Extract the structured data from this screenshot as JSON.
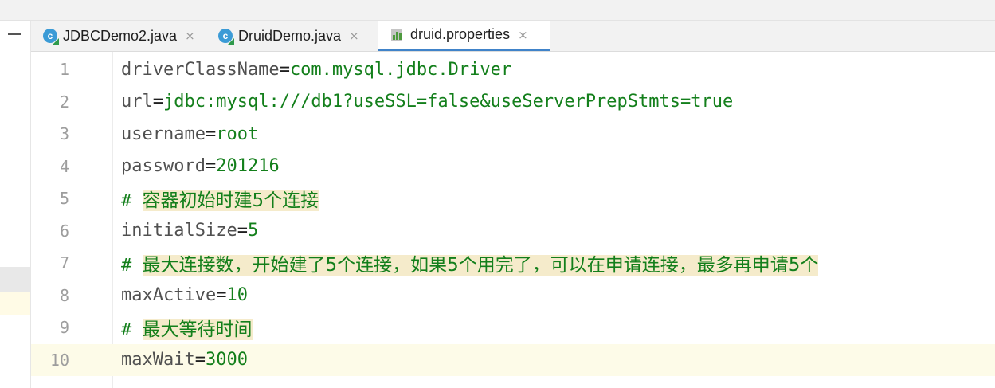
{
  "tabs": [
    {
      "label": "JDBCDemo2.java",
      "icon": "java-class-icon",
      "active": false
    },
    {
      "label": "DruidDemo.java",
      "icon": "java-class-icon",
      "active": false
    },
    {
      "label": "druid.properties",
      "icon": "properties-file-icon",
      "active": true
    }
  ],
  "close_glyph": "×",
  "editor": {
    "current_line": 10,
    "lines": [
      {
        "num": "1",
        "key": "driverClassName",
        "eq": "=",
        "value": "com.mysql.jdbc.Driver"
      },
      {
        "num": "2",
        "key": "url",
        "eq": "=",
        "value": "jdbc:mysql:///db1?useSSL=false&useServerPrepStmts=true"
      },
      {
        "num": "3",
        "key": "username",
        "eq": "=",
        "value": "root"
      },
      {
        "num": "4",
        "key": "password",
        "eq": "=",
        "value": "201216"
      },
      {
        "num": "5",
        "comment_prefix": "# ",
        "comment": "容器初始时建5个连接"
      },
      {
        "num": "6",
        "key": "initialSize",
        "eq": "=",
        "value": "5"
      },
      {
        "num": "7",
        "comment_prefix": "# ",
        "comment": "最大连接数，开始建了5个连接，如果5个用完了，可以在申请连接，最多再申请5个"
      },
      {
        "num": "8",
        "key": "maxActive",
        "eq": "=",
        "value": "10"
      },
      {
        "num": "9",
        "comment_prefix": "# ",
        "comment": "最大等待时间"
      },
      {
        "num": "10",
        "key": "maxWait",
        "eq": "=",
        "value": "3000"
      }
    ]
  }
}
